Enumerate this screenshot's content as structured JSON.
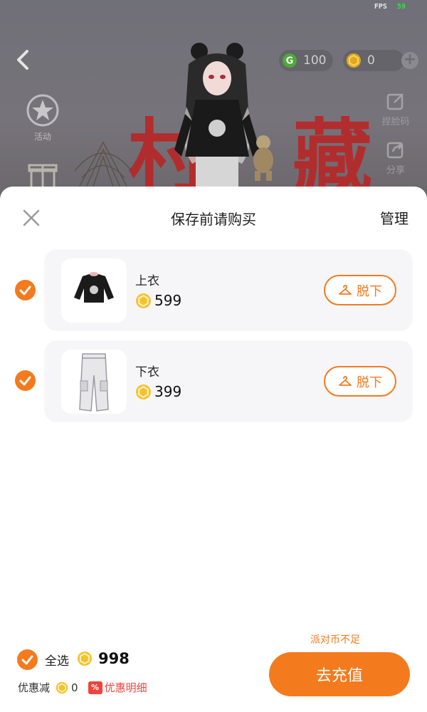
{
  "status_bar": {
    "fps_label": "FPS",
    "fps_value": "59"
  },
  "header": {
    "currencies": [
      {
        "icon": "green-g-coin-icon",
        "value": "100",
        "color": "#4fa83a"
      },
      {
        "icon": "gold-coin-icon",
        "value": "0",
        "color": "#e0a81c"
      }
    ]
  },
  "scene": {
    "left_buttons": [
      {
        "label": "活动",
        "icon": "star-badge-icon"
      },
      {
        "label": "",
        "icon": "gift-box-icon"
      }
    ],
    "right_buttons": [
      {
        "label": "捏脸码",
        "icon": "edit-icon"
      },
      {
        "label": "分享",
        "icon": "share-icon"
      }
    ],
    "backdrop_text": "村 藏"
  },
  "sheet": {
    "title": "保存前请购买",
    "manage_label": "管理",
    "items": [
      {
        "name": "上衣",
        "price": "599",
        "action_label": "脱下",
        "checked": true,
        "thumb_icon": "black-jacket-icon"
      },
      {
        "name": "下衣",
        "price": "399",
        "action_label": "脱下",
        "checked": true,
        "thumb_icon": "white-cargo-pants-icon"
      }
    ]
  },
  "footer": {
    "select_all_label": "全选",
    "total": "998",
    "discount_label": "优惠减",
    "discount_amount": "0",
    "discount_detail_badge": "%",
    "discount_detail_label": "优惠明细",
    "insufficient_label": "派对币不足",
    "recharge_label": "去充值"
  },
  "colors": {
    "accent": "#f47a1e",
    "discount_red": "#f0433c",
    "card_bg": "#f6f6f8"
  }
}
